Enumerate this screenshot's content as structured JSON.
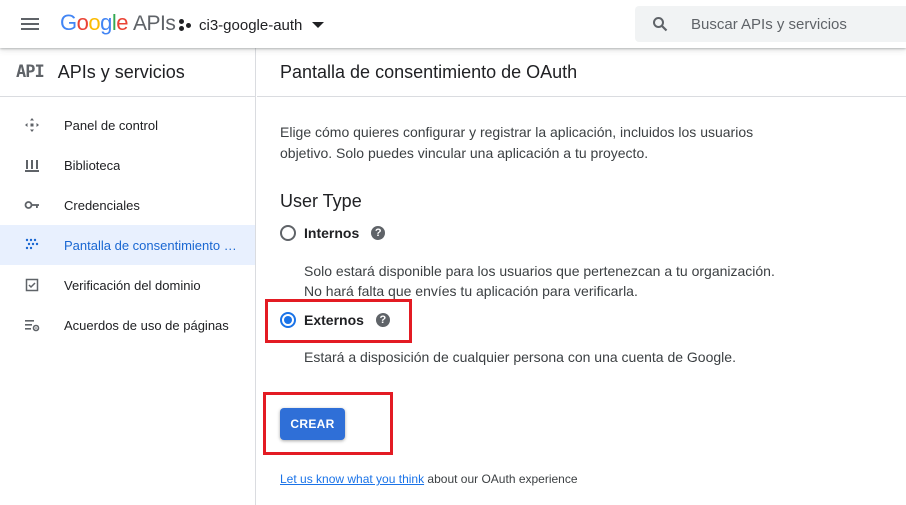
{
  "header": {
    "logo_letters": [
      "G",
      "o",
      "o",
      "g",
      "l",
      "e"
    ],
    "logo_suffix": "APIs",
    "project_name": "ci3-google-auth",
    "search_placeholder": "Buscar APIs y servicios"
  },
  "sidebar": {
    "badge": "API",
    "title": "APIs y servicios",
    "items": [
      {
        "label": "Panel de control",
        "icon": "dashboard-icon",
        "active": false
      },
      {
        "label": "Biblioteca",
        "icon": "library-icon",
        "active": false
      },
      {
        "label": "Credenciales",
        "icon": "key-icon",
        "active": false
      },
      {
        "label": "Pantalla de consentimiento …",
        "icon": "consent-screen-icon",
        "active": true
      },
      {
        "label": "Verificación del dominio",
        "icon": "domain-check-icon",
        "active": false
      },
      {
        "label": "Acuerdos de uso de páginas",
        "icon": "page-settings-icon",
        "active": false
      }
    ]
  },
  "main": {
    "title": "Pantalla de consentimiento de OAuth",
    "intro": "Elige cómo quieres configurar y registrar la aplicación, incluidos los usuarios objetivo. Solo puedes vincular una aplicación a tu proyecto.",
    "section_title": "User Type",
    "options": [
      {
        "label": "Internos",
        "checked": false,
        "description": "Solo estará disponible para los usuarios que pertenezcan a tu organización. No hará falta que envíes tu aplicación para verificarla."
      },
      {
        "label": "Externos",
        "checked": true,
        "description": "Estará a disposición de cualquier persona con una cuenta de Google."
      }
    ],
    "create_label": "CREAR",
    "feedback_link": "Let us know what you think",
    "feedback_suffix": " about our OAuth experience"
  },
  "colors": {
    "accent": "#1a73e8",
    "button": "#2f6fd7",
    "annotation_red": "#e31b23",
    "active_bg": "#e8f0fe"
  }
}
